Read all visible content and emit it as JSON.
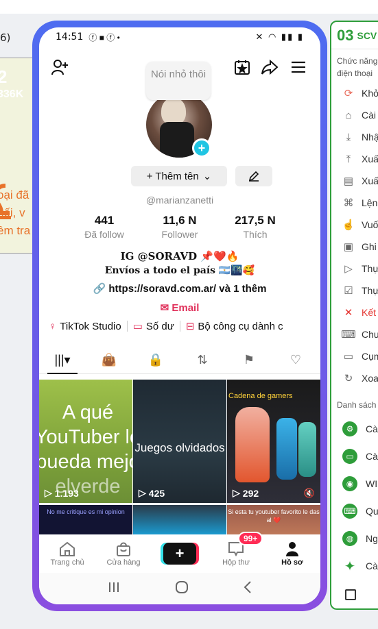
{
  "background": {
    "left_label": "6)",
    "card_number": "2",
    "card_sub": "336K",
    "card_lines": [
      "oại đã",
      "nối, v",
      "ềm tra"
    ],
    "accent_color": "#e8722a"
  },
  "right_panel": {
    "badge": "03",
    "title": "SCV",
    "section1": "Chức năng điện thoại",
    "items": [
      {
        "icon": "refresh-icon",
        "label": "Khở",
        "danger": false
      },
      {
        "icon": "sweep-icon",
        "label": "Cài",
        "danger": false
      },
      {
        "icon": "download-icon",
        "label": "Nhậ",
        "danger": false
      },
      {
        "icon": "upload-icon",
        "label": "Xuấ",
        "danger": false
      },
      {
        "icon": "clipboard-icon",
        "label": "Xuấ",
        "danger": false
      },
      {
        "icon": "command-icon",
        "label": "Lệnh",
        "danger": false
      },
      {
        "icon": "touch-icon",
        "label": "Vuố",
        "danger": false
      },
      {
        "icon": "record-icon",
        "label": "Ghi",
        "danger": false
      },
      {
        "icon": "play-icon",
        "label": "Thự",
        "danger": false
      },
      {
        "icon": "check-doc-icon",
        "label": "Thự",
        "danger": false
      },
      {
        "icon": "close-icon",
        "label": "Kết",
        "danger": true
      },
      {
        "icon": "keyboard-icon",
        "label": "Chu",
        "danger": false
      },
      {
        "icon": "message-icon",
        "label": "Cụm",
        "danger": false
      },
      {
        "icon": "rotate-icon",
        "label": "Xoa",
        "danger": false
      }
    ],
    "section2": "Danh sách",
    "apps": [
      {
        "icon": "settings-icon",
        "label": "Cà"
      },
      {
        "icon": "screen-icon",
        "label": "Cà"
      },
      {
        "icon": "wifi-icon",
        "label": "WI"
      },
      {
        "icon": "keyboard-icon",
        "label": "Qu"
      },
      {
        "icon": "globe-icon",
        "label": "Ng"
      },
      {
        "icon": "accessibility-icon",
        "label": "Cà"
      }
    ],
    "brand_color": "#2e9d3a"
  },
  "phone": {
    "status": {
      "time": "14:51",
      "icons": "✱ ⚓ ● •",
      "right": "🔇 ◉ ▎▎ 84"
    },
    "bubble_text": "Nói nhỏ thôi",
    "name_button": "+ Thêm tên",
    "handle": "@marianzanetti",
    "stats": [
      {
        "value": "441",
        "label": "Đã follow"
      },
      {
        "value": "11,6 N",
        "label": "Follower"
      },
      {
        "value": "217,5 N",
        "label": "Thích"
      }
    ],
    "bio_line1": "IG @SORAVD 📌❤️🔥",
    "bio_line2": "Envíos a todo el país 🇦🇷🌃🥰",
    "link": "https://soravd.com.ar/ và 1 thêm",
    "email": "Email",
    "tools": [
      "TikTok Studio",
      "Số dư",
      "Bộ công cụ dành c"
    ],
    "tabs": [
      "videos-tab",
      "shop-tab",
      "private-tab",
      "repost-tab",
      "favorites-tab",
      "liked-tab"
    ],
    "videos": [
      {
        "text": "A qué YouTuber lo puede mejor el verde",
        "lines": [
          "A qué",
          "YouTuber lo",
          "pueda mejo",
          "elverde"
        ],
        "plays": "1.193"
      },
      {
        "text": "Juegos olvidados",
        "plays": "425"
      },
      {
        "text": "Cadena de gamers",
        "plays": "292"
      }
    ],
    "videos_row2": [
      {
        "text": "No me critique es mi opinion"
      },
      {
        "text": ""
      },
      {
        "text": "Si esta tu youtuber favorito le das al ❤️"
      }
    ],
    "nav": [
      {
        "label": "Trang chủ",
        "icon": "home-icon"
      },
      {
        "label": "Cửa hàng",
        "icon": "shop-icon"
      },
      {
        "label": "",
        "icon": "create-icon"
      },
      {
        "label": "Hộp thư",
        "icon": "inbox-icon",
        "badge": "99+"
      },
      {
        "label": "Hồ sơ",
        "icon": "profile-icon"
      }
    ],
    "accent_color": "#e0315b"
  }
}
